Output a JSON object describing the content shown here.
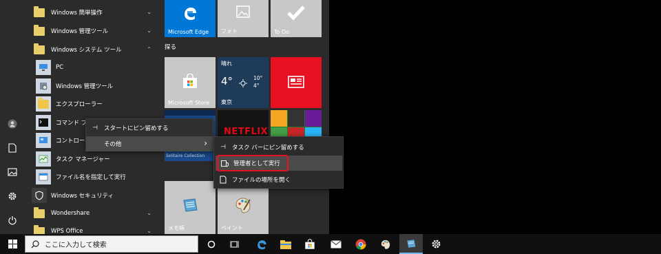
{
  "app_list": {
    "items": [
      {
        "label": "Windows 簡単操作",
        "chevron": "⌄",
        "icon": "folder-icon"
      },
      {
        "label": "Windows 管理ツール",
        "chevron": "⌄",
        "icon": "folder-icon"
      },
      {
        "label": "Windows システム ツール",
        "chevron": "⌃",
        "icon": "folder-icon"
      },
      {
        "label": "PC",
        "icon": "pc-icon"
      },
      {
        "label": "Windows 管理ツール",
        "icon": "admin-tools-icon"
      },
      {
        "label": "エクスプローラー",
        "icon": "explorer-icon"
      },
      {
        "label": "コマンド プロ",
        "icon": "command-prompt-icon"
      },
      {
        "label": "コントロール",
        "icon": "control-panel-icon"
      },
      {
        "label": "タスク マネージャー",
        "icon": "task-manager-icon"
      },
      {
        "label": "ファイル名を指定して実行",
        "icon": "run-icon"
      },
      {
        "label": "Windows セキュリティ",
        "icon": "shield-icon"
      },
      {
        "label": "Wondershare",
        "chevron": "⌄",
        "icon": "folder-icon"
      },
      {
        "label": "WPS Office",
        "chevron": "⌄",
        "icon": "folder-icon"
      }
    ]
  },
  "tiles": {
    "group_label": "探る",
    "edge": "Microsoft Edge",
    "photos": "フォト",
    "todo": "To Do",
    "store": "Microsoft Store",
    "weather": {
      "condition": "晴れ",
      "temp": "4°",
      "high": "10°",
      "low": "4°",
      "city": "東京"
    },
    "netflix": "NETFLIX",
    "solitaire": "Solitaire Collection",
    "notepad": "メモ帳",
    "paint": "ペイント"
  },
  "context_menu_1": {
    "pin_start": "スタートにピン留めする",
    "more": "その他",
    "more_arrow": "›"
  },
  "context_menu_2": {
    "pin_taskbar": "タスク バーにピン留めする",
    "run_as_admin": "管理者として実行",
    "open_location": "ファイルの場所を開く"
  },
  "taskbar": {
    "search_placeholder": "ここに入力して検索"
  },
  "colors": {
    "accent": "#0078d7",
    "highlight_red": "#e81123",
    "menu_bg": "#2b2b2b",
    "taskbar_bg": "#101010"
  }
}
